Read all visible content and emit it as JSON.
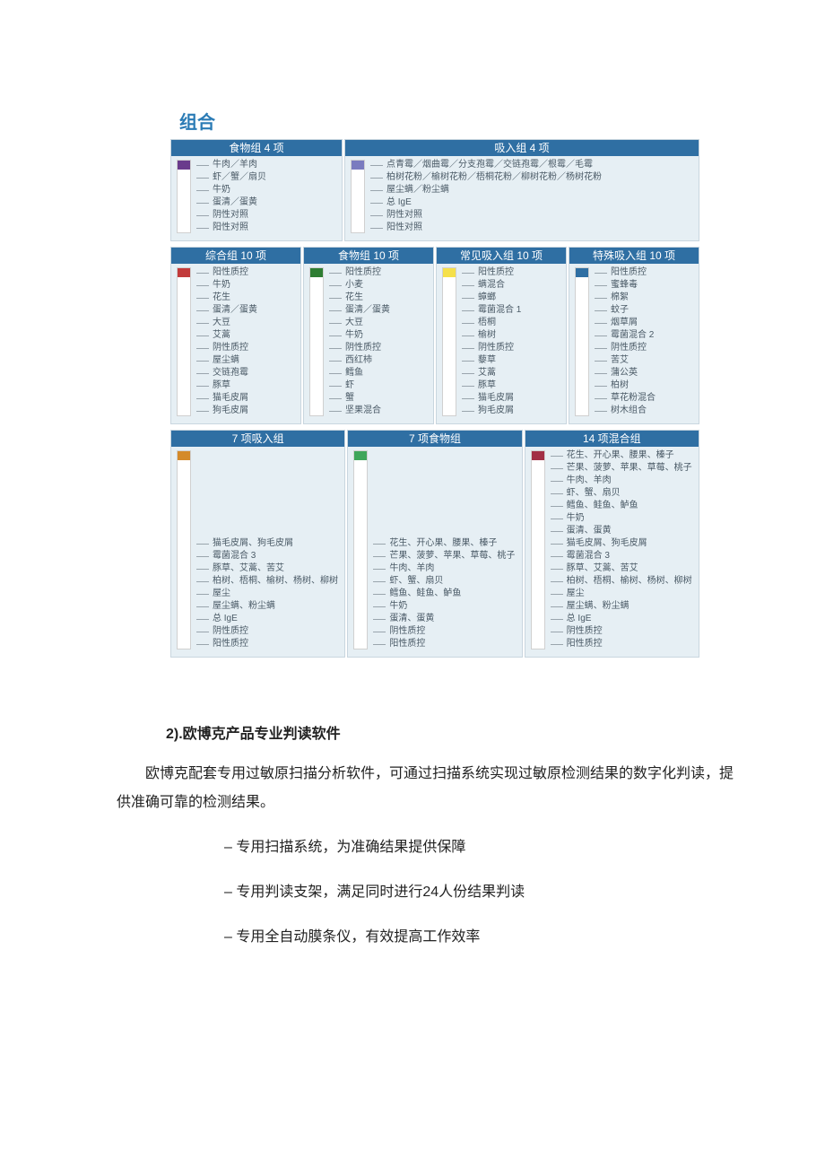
{
  "section_title": "组合",
  "row1": [
    {
      "title": "食物组 4 项",
      "color": "#6a3c8c",
      "items": [
        "牛肉／羊肉",
        "虾／蟹／扇贝",
        "牛奶",
        "蛋清／蛋黄",
        "阴性对照",
        "阳性对照"
      ]
    },
    {
      "title": "吸入组 4 项",
      "color": "#7a7bbf",
      "items": [
        "点青霉／烟曲霉／分支孢霉／交链孢霉／根霉／毛霉",
        "柏树花粉／榆树花粉／梧桐花粉／柳树花粉／杨树花粉",
        "屋尘螨／粉尘螨",
        "总 IgE",
        "阴性对照",
        "阳性对照"
      ]
    }
  ],
  "row2": [
    {
      "title": "综合组 10 项",
      "color": "#c23b3b",
      "items": [
        "阳性质控",
        "牛奶",
        "花生",
        "蛋清／蛋黄",
        "大豆",
        "艾蒿",
        "阴性质控",
        "屋尘螨",
        "交链孢霉",
        "豚草",
        "猫毛皮屑",
        "狗毛皮屑"
      ]
    },
    {
      "title": "食物组 10 项",
      "color": "#2e7d32",
      "items": [
        "阳性质控",
        "小麦",
        "花生",
        "蛋清／蛋黄",
        "大豆",
        "牛奶",
        "阴性质控",
        "西红柿",
        "鳕鱼",
        "虾",
        "蟹",
        "坚果混合"
      ]
    },
    {
      "title": "常见吸入组 10 项",
      "color": "#f5e04a",
      "items": [
        "阳性质控",
        "螨混合",
        "蟑螂",
        "霉菌混合 1",
        "梧桐",
        "榆树",
        "阴性质控",
        "藜草",
        "艾蒿",
        "豚草",
        "猫毛皮屑",
        "狗毛皮屑"
      ]
    },
    {
      "title": "特殊吸入组 10 项",
      "color": "#2f6fa3",
      "items": [
        "阳性质控",
        "蜜蜂毒",
        "棉絮",
        "蚊子",
        "烟草屑",
        "霉菌混合 2",
        "阴性质控",
        "苦艾",
        "蒲公英",
        "柏树",
        "草花粉混合",
        "树木组合"
      ]
    }
  ],
  "row3": [
    {
      "title": "7 项吸入组",
      "color": "#d48a2a",
      "items": [
        "猫毛皮屑、狗毛皮屑",
        "霉菌混合 3",
        "豚草、艾蒿、苦艾",
        "柏树、梧桐、榆树、杨树、柳树",
        "屋尘",
        "屋尘螨、粉尘螨",
        "总 IgE",
        "阴性质控",
        "阳性质控"
      ]
    },
    {
      "title": "7 项食物组",
      "color": "#3fa65a",
      "items": [
        "花生、开心果、腰果、榛子",
        "芒果、菠萝、苹果、草莓、桃子",
        "牛肉、羊肉",
        "虾、蟹、扇贝",
        "鳕鱼、鲑鱼、鲈鱼",
        "牛奶",
        "蛋清、蛋黄",
        "阴性质控",
        "阳性质控"
      ]
    },
    {
      "title": "14 项混合组",
      "color": "#a22f45",
      "items": [
        "花生、开心果、腰果、榛子",
        "芒果、菠萝、苹果、草莓、桃子",
        "牛肉、羊肉",
        "虾、蟹、扇贝",
        "鳕鱼、鲑鱼、鲈鱼",
        "牛奶",
        "蛋清、蛋黄",
        "猫毛皮屑、狗毛皮屑",
        "霉菌混合 3",
        "豚草、艾蒿、苦艾",
        "柏树、梧桐、榆树、杨树、柳树",
        "屋尘",
        "屋尘螨、粉尘螨",
        "总 IgE",
        "阴性质控",
        "阳性质控"
      ]
    }
  ],
  "text": {
    "h2": "2).欧博克产品专业判读软件",
    "para": "欧博克配套专用过敏原扫描分析软件，可通过扫描系统实现过敏原检测结果的数字化判读，提供准确可靠的检测结果。",
    "bullets": [
      "专用扫描系统，为准确结果提供保障",
      "专用判读支架，满足同时进行24人份结果判读",
      "专用全自动膜条仪，有效提高工作效率"
    ]
  }
}
